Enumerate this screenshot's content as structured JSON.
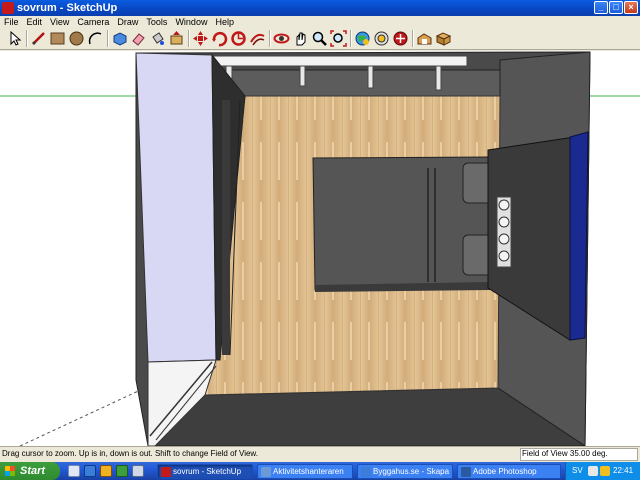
{
  "window": {
    "title": "sovrum - SketchUp",
    "controls": {
      "minimize": "_",
      "maximize": "□",
      "close": "×"
    }
  },
  "menu": {
    "items": [
      "File",
      "Edit",
      "View",
      "Camera",
      "Draw",
      "Tools",
      "Window",
      "Help"
    ]
  },
  "toolbar": {
    "tools": [
      "select-icon",
      "line-icon",
      "rectangle-icon",
      "circle-icon",
      "arc-icon",
      "make-component-icon",
      "eraser-icon",
      "paint-bucket-icon",
      "push-pull-icon",
      "move-icon",
      "rotate-icon",
      "follow-me-icon",
      "orbit-icon",
      "pan-icon",
      "zoom-icon",
      "zoom-extents-icon",
      "get-models-icon",
      "share-model-icon",
      "components-icon",
      "3d-warehouse-icon"
    ]
  },
  "status": {
    "hint": "Drag cursor to zoom.  Up is in, down is out.  Shift to change Field of View.",
    "field_of_view": "Field of View 35.00 deg."
  },
  "taskbar": {
    "start_label": "Start",
    "tasks": [
      {
        "label": "sovrum - SketchUp",
        "active": true
      },
      {
        "label": "Aktivitetshanteraren",
        "active": false
      },
      {
        "label": "Byggahus.se - Skapa ...",
        "active": false
      },
      {
        "label": "Adobe Photoshop",
        "active": false
      }
    ],
    "tray": {
      "language": "SV",
      "clock": "22:41"
    }
  },
  "colors": {
    "titlebar": "#0846c2",
    "floor": "#d8b98a",
    "walls": "#3d3d3d",
    "wardrobe": "#d6d6f2",
    "bed": "#555555",
    "taskbar": "#245edb",
    "start_button": "#2f8a2f"
  }
}
